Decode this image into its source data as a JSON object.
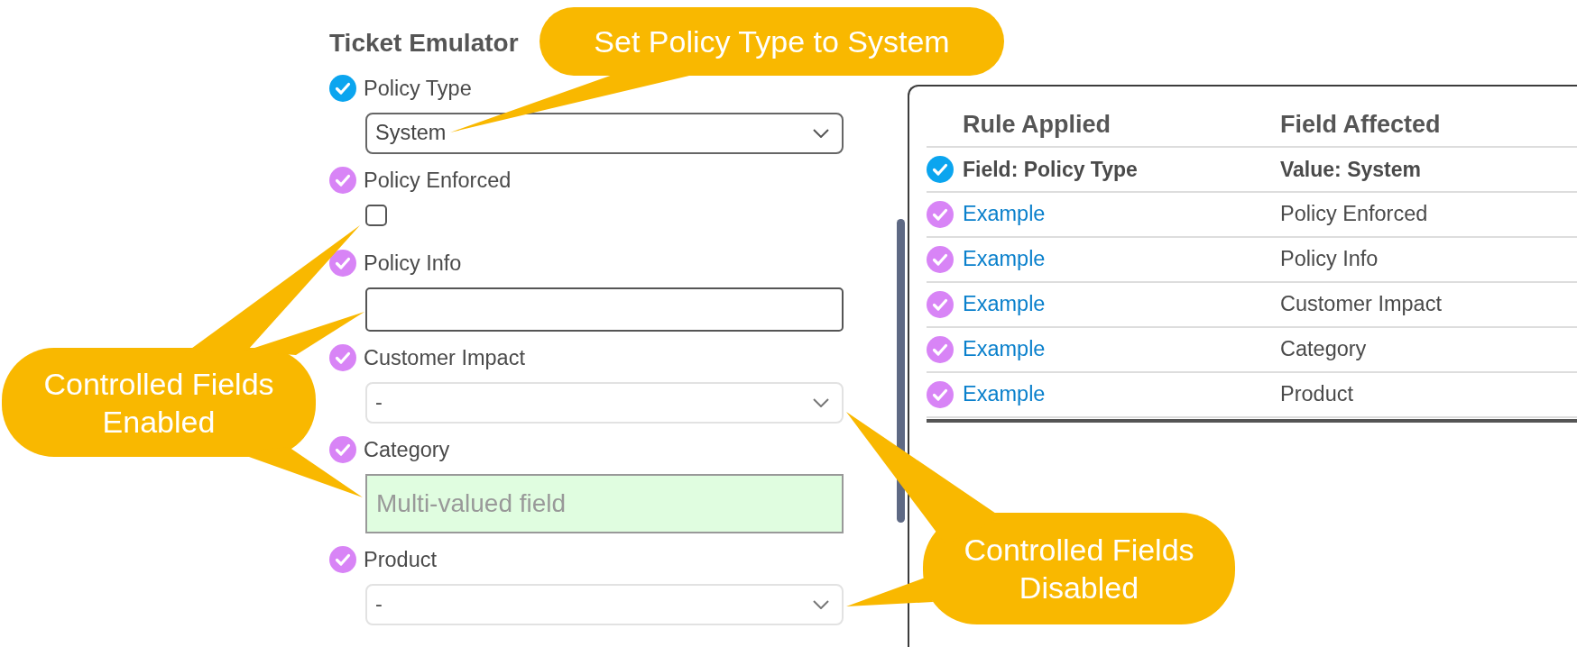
{
  "form": {
    "title": "Ticket Emulator",
    "fields": [
      {
        "label": "Policy Type",
        "color": "#0ba5ef",
        "kind": "select",
        "value": "System",
        "disabled": false
      },
      {
        "label": "Policy Enforced",
        "color": "#d884f6",
        "kind": "checkbox",
        "checked": false,
        "disabled": false
      },
      {
        "label": "Policy Info",
        "color": "#d884f6",
        "kind": "text",
        "disabled": false
      },
      {
        "label": "Customer Impact",
        "color": "#d884f6",
        "kind": "select",
        "value": "-",
        "disabled": true
      },
      {
        "label": "Category",
        "color": "#d884f6",
        "kind": "multi",
        "placeholder": "Multi-valued field",
        "disabled": false
      },
      {
        "label": "Product",
        "color": "#d884f6",
        "kind": "select",
        "value": "-",
        "disabled": true
      }
    ]
  },
  "table": {
    "columns": [
      "Rule Applied",
      "Field Affected"
    ],
    "rows": [
      {
        "kind": "trigger",
        "color": "#0ba5ef",
        "rule_applied": "Field: Policy Type",
        "field_affected": "Value: System"
      },
      {
        "kind": "rule",
        "color": "#d884f6",
        "rule_applied": "Example",
        "field_affected": "Policy Enforced"
      },
      {
        "kind": "rule",
        "color": "#d884f6",
        "rule_applied": "Example",
        "field_affected": "Policy Info"
      },
      {
        "kind": "rule",
        "color": "#d884f6",
        "rule_applied": "Example",
        "field_affected": "Customer Impact"
      },
      {
        "kind": "rule",
        "color": "#d884f6",
        "rule_applied": "Example",
        "field_affected": "Category"
      },
      {
        "kind": "rule",
        "color": "#d884f6",
        "rule_applied": "Example",
        "field_affected": "Product"
      }
    ]
  },
  "callouts": [
    {
      "text": "Set Policy Type to System"
    },
    {
      "text": "Controlled Fields Enabled"
    },
    {
      "text": "Controlled Fields Disabled"
    }
  ]
}
